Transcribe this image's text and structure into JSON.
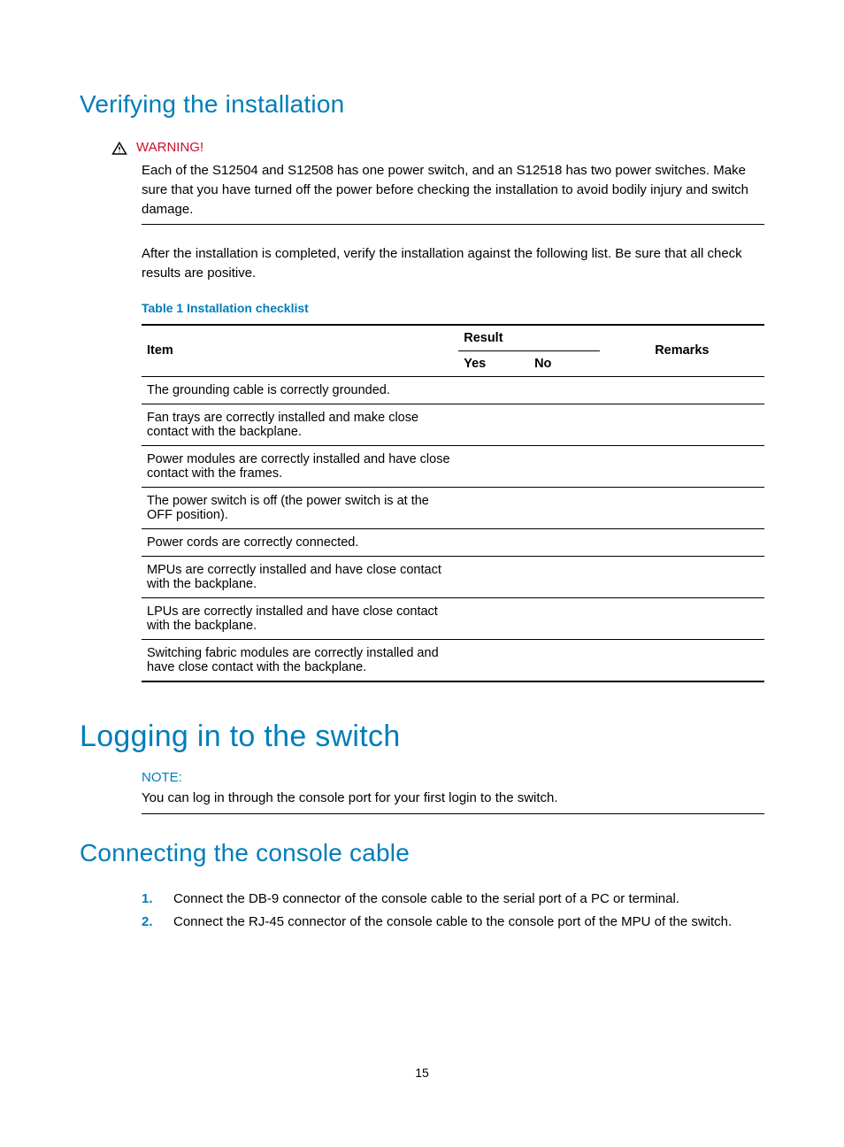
{
  "section1": {
    "title": "Verifying the installation",
    "warning_label": "WARNING!",
    "warning_text": "Each of the S12504 and S12508 has one power switch, and an S12518 has two power switches. Make sure that you have turned off the power before checking the installation to avoid bodily injury and switch damage.",
    "intro": "After the installation is completed, verify the installation against the following list. Be sure that all check results are positive.",
    "table_caption": "Table 1 Installation checklist",
    "headers": {
      "item": "Item",
      "result": "Result",
      "yes": "Yes",
      "no": "No",
      "remarks": "Remarks"
    },
    "rows": [
      "The grounding cable is correctly grounded.",
      "Fan trays are correctly installed and make close contact with the backplane.",
      "Power modules are correctly installed and have close contact with the frames.",
      "The power switch is off (the power switch is at the OFF position).",
      "Power cords are correctly connected.",
      "MPUs are correctly installed and have close contact with the backplane.",
      "LPUs are correctly installed and have close contact with the backplane.",
      "Switching fabric modules are correctly installed and have close contact with the backplane."
    ]
  },
  "section2": {
    "title": "Logging in to the switch",
    "note_label": "NOTE:",
    "note_text": "You can log in through the console port for your first login to the switch."
  },
  "section3": {
    "title": "Connecting the console cable",
    "steps": [
      "Connect the DB-9 connector of the console cable to the serial port of a PC or terminal.",
      "Connect the RJ-45 connector of the console cable to the console port of the MPU of the switch."
    ]
  },
  "page_number": "15"
}
